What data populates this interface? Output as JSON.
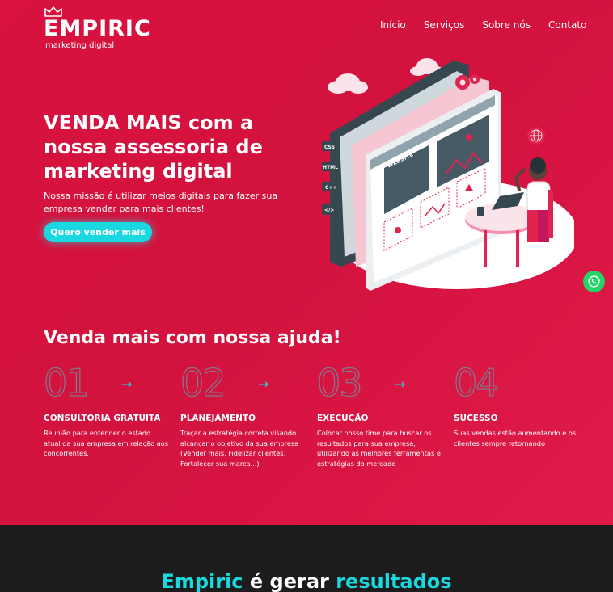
{
  "brand": {
    "name": "EMPIRIC",
    "tagline": "marketing digital"
  },
  "nav": {
    "items": [
      "Início",
      "Serviços",
      "Sobre nós",
      "Contato"
    ]
  },
  "hero": {
    "headline": "VENDA MAIS com a nossa assessoria de marketing digital",
    "subline": "Nossa missão é utilizar meios digitais para fazer sua empresa vender para mais clientes!",
    "cta_label": "Quero vender mais"
  },
  "illustration": {
    "website_label": "WEBSITE",
    "code_badges": [
      "CSS",
      "HTML",
      "C++",
      "</>"
    ]
  },
  "steps_section": {
    "title": "Venda mais com nossa ajuda!",
    "arrow_glyph": "→",
    "steps": [
      {
        "number": "01",
        "title": "CONSULTORIA GRATUITA",
        "desc": "Reunião para entender o estado atual da sua empresa em relação aos concorrentes."
      },
      {
        "number": "02",
        "title": "PLANEJAMENTO",
        "desc": "Traçar a estratégia correta visando alcançar o objetivo da sua empresa (Vender mais, Fidelizar clientes, Fortalecer sua marca...)"
      },
      {
        "number": "03",
        "title": "EXECUÇÃO",
        "desc": "Colocar nosso time para buscar os resultados para sua empresa, utilizando as melhores ferramentas e estratégias do mercado"
      },
      {
        "number": "04",
        "title": "SUCESSO",
        "desc": "Suas vendas estão aumentando e os clientes sempre retornando"
      }
    ]
  },
  "bottom": {
    "part1": "Empiric",
    "part2": " é gerar ",
    "part3": "resultados"
  },
  "icons": {
    "crown": "crown-icon",
    "whatsapp": "whatsapp-icon",
    "arrow": "arrow-right-icon"
  },
  "colors": {
    "primary": "#d9123f",
    "accent": "#19d8e0",
    "dark": "#1c1c1c",
    "whatsapp": "#25d366"
  }
}
